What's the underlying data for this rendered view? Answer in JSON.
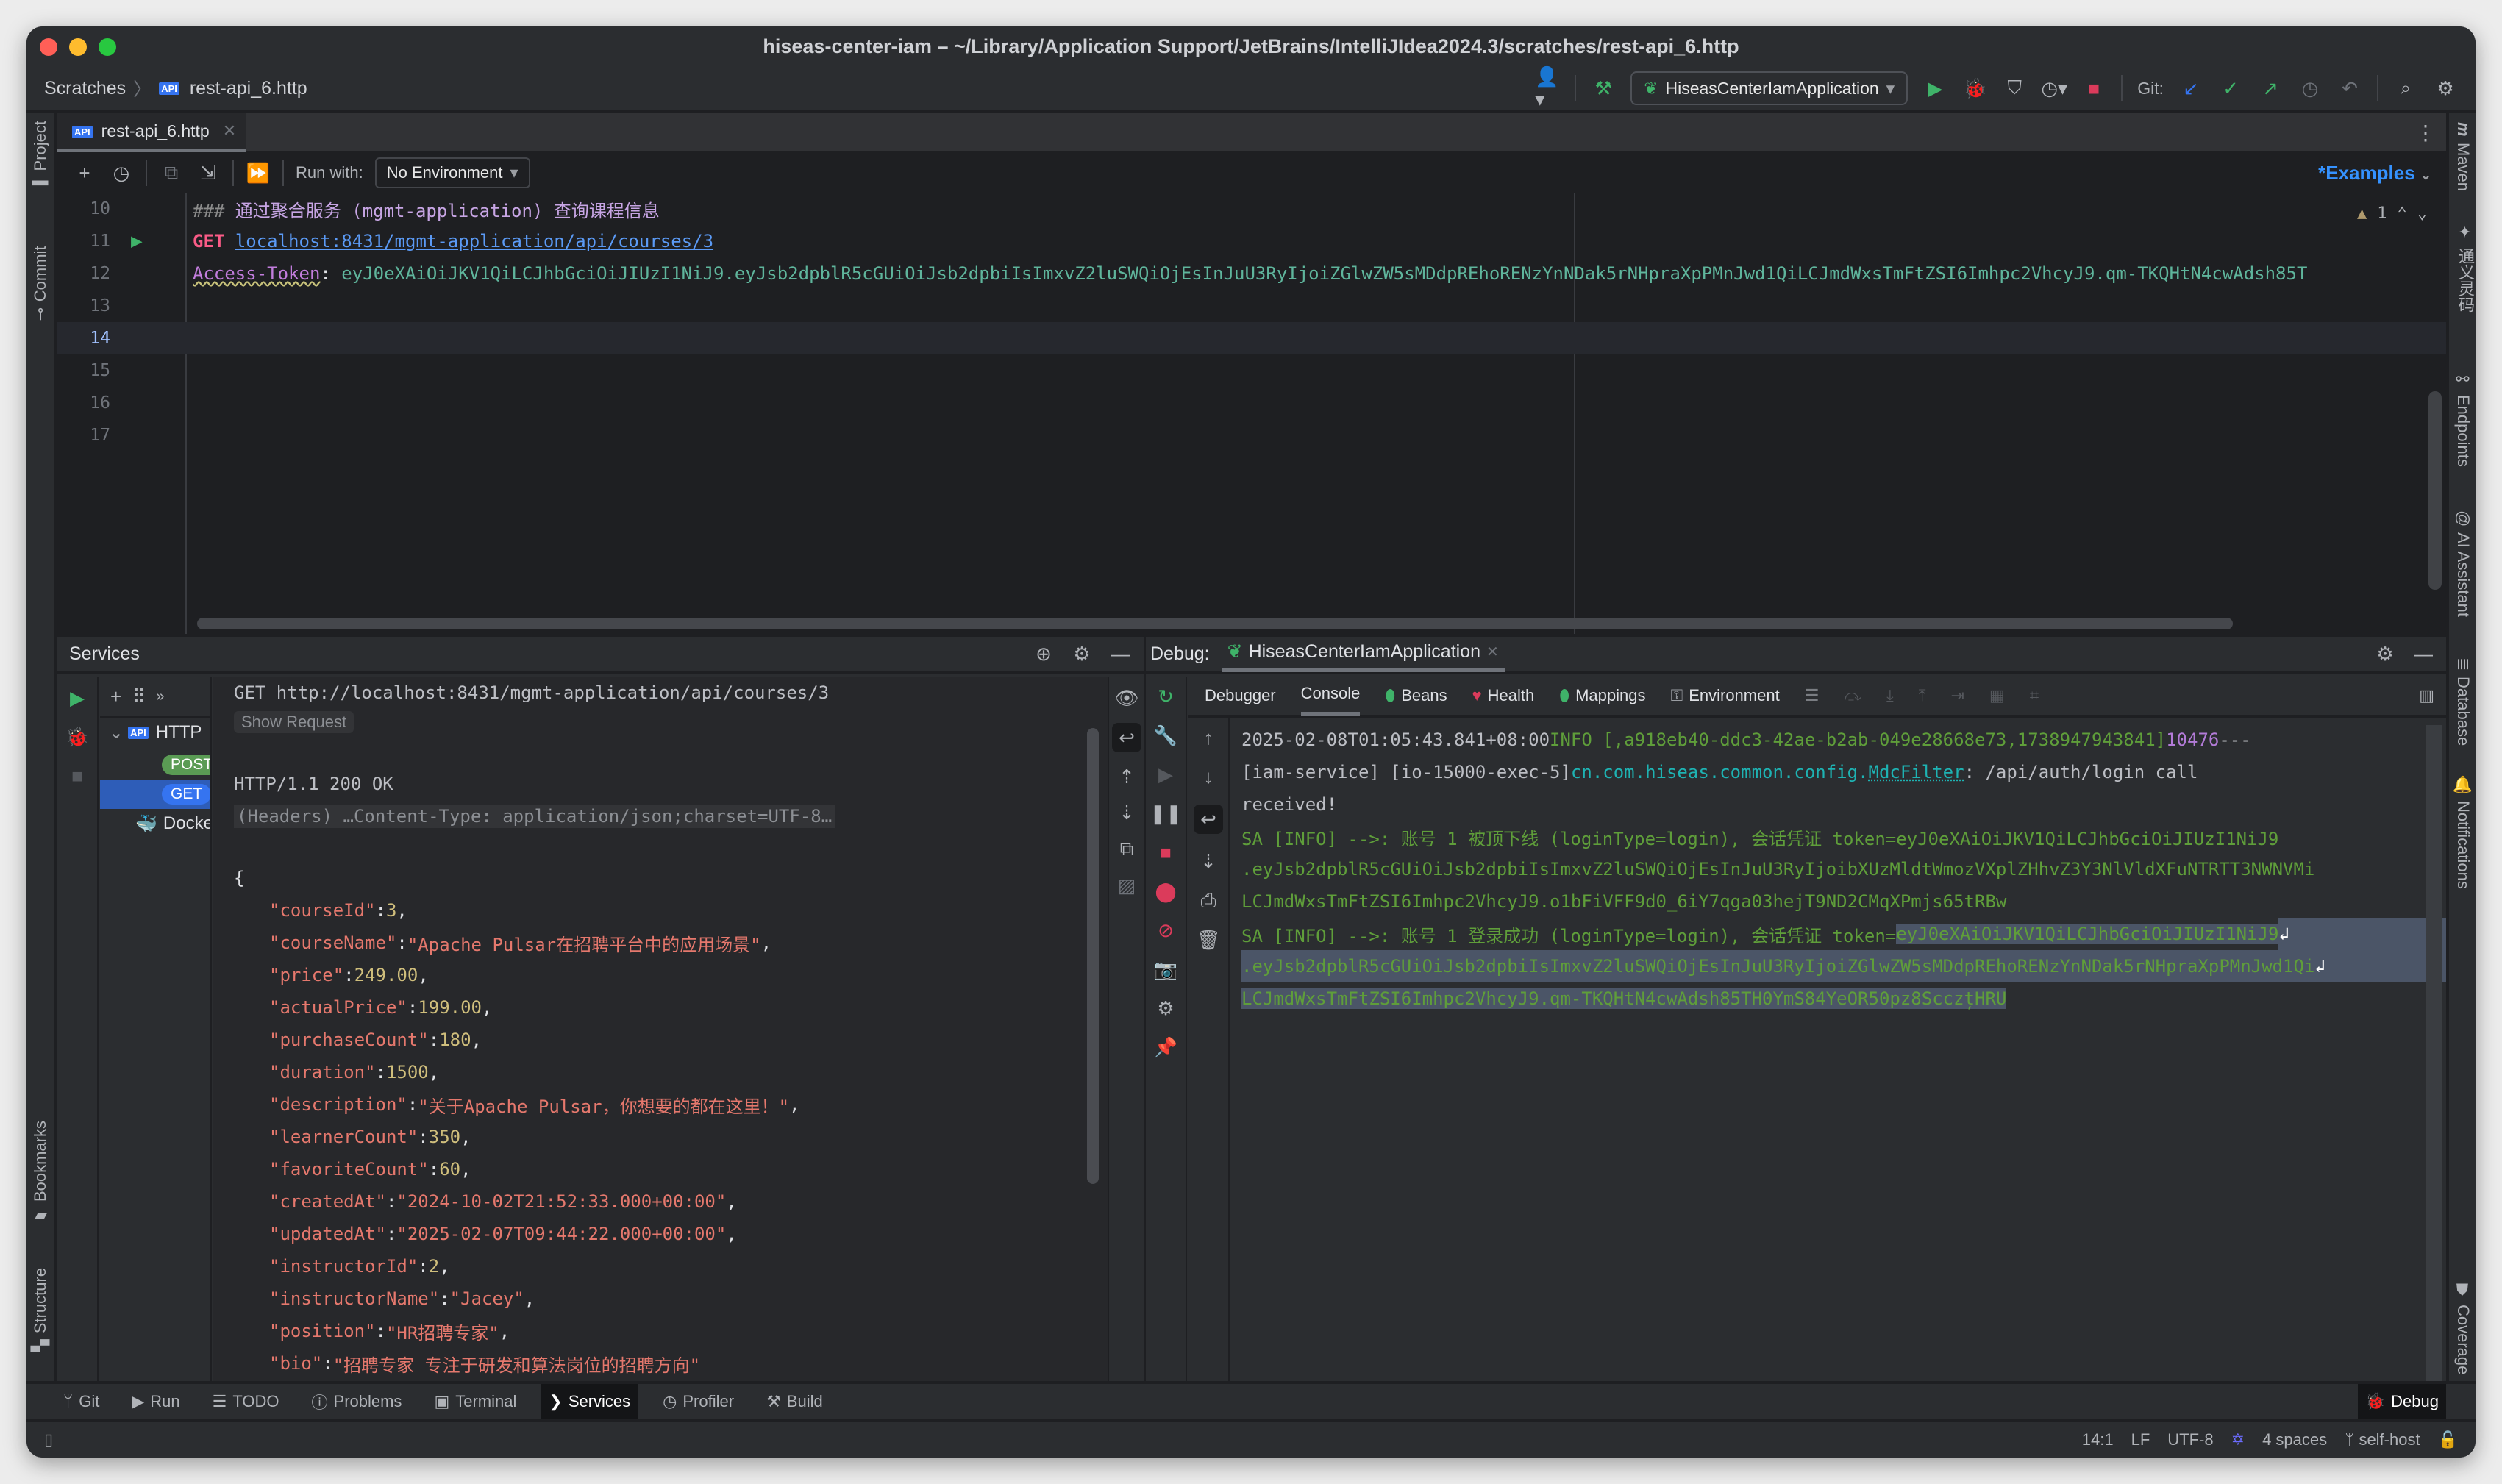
{
  "window": {
    "title": "hiseas-center-iam – ~/Library/Application Support/JetBrains/IntelliJIdea2024.3/scratches/rest-api_6.http",
    "traffic_colors": {
      "close": "#ff5f57",
      "minimize": "#febc2e",
      "zoom": "#28c840"
    }
  },
  "navbar": {
    "breadcrumb": [
      "Scratches",
      "rest-api_6.http"
    ],
    "run_config": "HiseasCenterIamApplication",
    "git_label": "Git:"
  },
  "left_stripe": {
    "top": [
      "Project",
      "Commit"
    ],
    "bottom": [
      "Bookmarks",
      "Structure"
    ]
  },
  "right_stripe": {
    "items": [
      "Maven",
      "通义灵码",
      "Endpoints",
      "AI Assistant",
      "Database",
      "Notifications",
      "Coverage"
    ]
  },
  "editor": {
    "tab": "rest-api_6.http",
    "api_badge": "API",
    "run_with_label": "Run with:",
    "environment": "No Environment",
    "examples_label": "*Examples",
    "warning_count": "1",
    "lines": [
      {
        "num": "10",
        "comment": "###",
        "text": " 通过聚合服务 (mgmt-application) 查询课程信息"
      },
      {
        "num": "11",
        "method": "GET",
        "url": "localhost:8431/mgmt-application/api/courses/3"
      },
      {
        "num": "12",
        "header_key": "Access-Token",
        "header_value": "eyJ0eXAiOiJKV1QiLCJhbGciOiJIUzI1NiJ9.eyJsb2dpblR5cGUiOiJsb2dpbiIsImxvZ2luSWQiOjEsInJuU3RyIjoiZGlwZW5sMDdpREhoRENzYnNDak5rNHpraXpPMnJwd1QiLCJmdWxsTmFtZSI6Imhpc2VhcyJ9.qm-TKQHtN4cwAdsh85T"
      },
      {
        "num": "13"
      },
      {
        "num": "14"
      },
      {
        "num": "15"
      },
      {
        "num": "16"
      },
      {
        "num": "17"
      }
    ],
    "current_line": "14"
  },
  "services": {
    "title": "Services",
    "tree": {
      "root": "HTTP",
      "items": [
        {
          "label": "POST",
          "color": "#5a9b54"
        },
        {
          "label": "GET",
          "color": "#3574f0",
          "selected": true
        }
      ],
      "docker": "Docker"
    },
    "response": {
      "request_line": "GET http://localhost:8431/mgmt-application/api/courses/3",
      "show_request": "Show Request",
      "status_line": "HTTP/1.1 200 OK",
      "headers_summary": "(Headers) …Content-Type: application/json;charset=UTF-8…",
      "open_brace": "{",
      "close_brace": "}",
      "fields": [
        {
          "key": "\"courseId\"",
          "value": "3",
          "type": "num",
          "comma": ","
        },
        {
          "key": "\"courseName\"",
          "value": "\"Apache Pulsar在招聘平台中的应用场景\"",
          "type": "str",
          "comma": ","
        },
        {
          "key": "\"price\"",
          "value": "249.00",
          "type": "num",
          "comma": ","
        },
        {
          "key": "\"actualPrice\"",
          "value": "199.00",
          "type": "num",
          "comma": ","
        },
        {
          "key": "\"purchaseCount\"",
          "value": "180",
          "type": "num",
          "comma": ","
        },
        {
          "key": "\"duration\"",
          "value": "1500",
          "type": "num",
          "comma": ","
        },
        {
          "key": "\"description\"",
          "value": "\"关于Apache Pulsar，你想要的都在这里！\"",
          "type": "str",
          "comma": ","
        },
        {
          "key": "\"learnerCount\"",
          "value": "350",
          "type": "num",
          "comma": ","
        },
        {
          "key": "\"favoriteCount\"",
          "value": "60",
          "type": "num",
          "comma": ","
        },
        {
          "key": "\"createdAt\"",
          "value": "\"2024-10-02T21:52:33.000+00:00\"",
          "type": "str",
          "comma": ","
        },
        {
          "key": "\"updatedAt\"",
          "value": "\"2025-02-07T09:44:22.000+00:00\"",
          "type": "str",
          "comma": ","
        },
        {
          "key": "\"instructorId\"",
          "value": "2",
          "type": "num",
          "comma": ","
        },
        {
          "key": "\"instructorName\"",
          "value": "\"Jacey\"",
          "type": "str",
          "comma": ","
        },
        {
          "key": "\"position\"",
          "value": "\"HR招聘专家\"",
          "type": "str",
          "comma": ","
        },
        {
          "key": "\"bio\"",
          "value": "\"招聘专家 专注于研发和算法岗位的招聘方向\"",
          "type": "str",
          "comma": ""
        }
      ]
    }
  },
  "debug": {
    "label": "Debug:",
    "session": "HiseasCenterIamApplication",
    "tabs": [
      "Debugger",
      "Console",
      "Beans",
      "Health",
      "Mappings",
      "Environment"
    ],
    "active_tab": "Console",
    "console": {
      "line1": {
        "timestamp": "2025-02-08T01:05:43.841+08:00",
        "level": "  INFO [,a918eb40-ddc3-42ae-b2ab-049e28668e73,1738947943841]",
        "pid": " 10476",
        "dashes": " ---"
      },
      "line2": {
        "thread": " [iam-service] [io-15000-exec-5] ",
        "logger_pkg": "cn.com.hiseas.common.config.",
        "logger_class": "MdcFilter",
        "message": "    : /api/auth/login call"
      },
      "line3": " received!",
      "sa1": [
        "SA [INFO] -->: 账号 1 被顶下线 (loginType=login), 会话凭证 token=eyJ0eXAiOiJKV1QiLCJhbGciOiJIUzI1NiJ9",
        " .eyJsb2dpblR5cGUiOiJsb2dpbiIsImxvZ2luSWQiOjEsInJuU3RyIjoibXUzMldtWmozVXplZHhvZ3Y3NlVldXFuNTRTT3NWNVMi",
        " LCJmdWxsTmFtZSI6Imhpc2VhcyJ9.o1bFiVFF9d0_6iY7qga03hejT9ND2CMqXPmjs65tRBw"
      ],
      "sa2_prefix": "SA [INFO] -->: 账号 1 登录成功 (loginType=login), 会话凭证 token=",
      "sa2_selected": [
        "eyJ0eXAiOiJKV1QiLCJhbGciOiJIUzI1NiJ9",
        ".eyJsb2dpblR5cGUiOiJsb2dpbiIsImxvZ2luSWQiOjEsInJuU3RyIjoiZGlwZW5sMDdpREhoRENzYnNDak5rNHpraXpPMnJwd1Qi",
        "LCJmdWxsTmFtZSI6Imhpc2VhcyJ9.qm-TKQHtN4cwAdsh85TH0YmS84YeOR50pz8ScczțHRU"
      ]
    }
  },
  "toolwindows": {
    "items": [
      "Git",
      "Run",
      "TODO",
      "Problems",
      "Terminal",
      "Services",
      "Profiler",
      "Build"
    ],
    "active": "Services",
    "right": "Debug"
  },
  "statusbar": {
    "position": "14:1",
    "line_sep": "LF",
    "encoding": "UTF-8",
    "indent": "4 spaces",
    "branch": "self-host"
  }
}
